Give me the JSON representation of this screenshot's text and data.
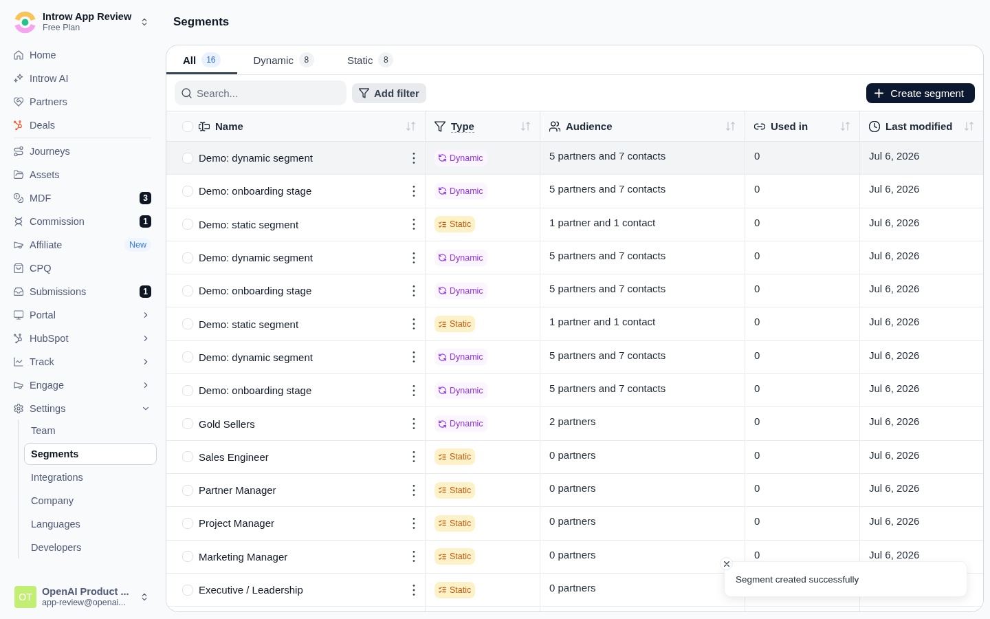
{
  "sidebar": {
    "workspace": {
      "name": "Introw App Review",
      "plan": "Free Plan"
    },
    "nav_groups": [
      {
        "items": [
          {
            "label": "Home",
            "kind": "link",
            "selected": false
          },
          {
            "label": "Introw AI",
            "kind": "link",
            "selected": false
          },
          {
            "label": "Partners",
            "kind": "link",
            "selected": false
          },
          {
            "label": "Deals",
            "kind": "link",
            "selected": false
          }
        ]
      },
      {
        "items": [
          {
            "label": "Journeys",
            "kind": "link",
            "selected": false
          },
          {
            "label": "Assets",
            "kind": "link",
            "selected": false
          },
          {
            "label": "MDF",
            "kind": "link",
            "selected": false,
            "count": "3"
          },
          {
            "label": "Commission",
            "kind": "link",
            "selected": false,
            "count": "1"
          },
          {
            "label": "Affiliate",
            "kind": "link",
            "selected": false,
            "tag": "New"
          },
          {
            "label": "CPQ",
            "kind": "link",
            "selected": false
          },
          {
            "label": "Submissions",
            "kind": "link",
            "selected": false,
            "count": "1"
          },
          {
            "label": "Portal",
            "kind": "group",
            "selected": false,
            "expanded": false
          },
          {
            "label": "HubSpot",
            "kind": "group",
            "selected": false,
            "expanded": false
          },
          {
            "label": "Track",
            "kind": "group",
            "selected": false,
            "expanded": false
          },
          {
            "label": "Engage",
            "kind": "group",
            "selected": false,
            "expanded": false
          },
          {
            "label": "Settings",
            "kind": "group",
            "selected": false,
            "expanded": true,
            "children": [
              {
                "label": "Team",
                "selected": false
              },
              {
                "label": "Segments",
                "selected": true
              },
              {
                "label": "Integrations",
                "selected": false
              },
              {
                "label": "Company",
                "selected": false
              },
              {
                "label": "Languages",
                "selected": false
              },
              {
                "label": "Developers",
                "selected": false
              }
            ]
          }
        ]
      }
    ],
    "account": {
      "initials": "OT",
      "name": "OpenAI Product ...",
      "email": "app-review@openai..."
    }
  },
  "main": {
    "title": "Segments",
    "tabs": [
      {
        "label": "All",
        "count": "16",
        "selected": true
      },
      {
        "label": "Dynamic",
        "count": "8",
        "selected": false
      },
      {
        "label": "Static",
        "count": "8",
        "selected": false
      }
    ],
    "search": {
      "placeholder": "Search..."
    },
    "filter_button": "Add filter",
    "create_button": "Create segment",
    "table": {
      "select_all": {
        "checked": false
      },
      "columns": [
        {
          "label": "Name",
          "has_tooltip": false
        },
        {
          "label": "Type",
          "has_tooltip": true
        },
        {
          "label": "Audience",
          "has_tooltip": false
        },
        {
          "label": "Used in",
          "has_tooltip": false
        },
        {
          "label": "Last modified",
          "has_tooltip": false
        }
      ],
      "rows": [
        {
          "name": "Demo: dynamic segment",
          "type": {
            "kind": "dynamic",
            "label": "Dynamic"
          },
          "audience": "5 partners and 7 contacts",
          "used_in": "0",
          "last_modified": "Jul 6, 2026",
          "checked": false,
          "hovered": true
        },
        {
          "name": "Demo: onboarding stage",
          "type": {
            "kind": "dynamic",
            "label": "Dynamic"
          },
          "audience": "5 partners and 7 contacts",
          "used_in": "0",
          "last_modified": "Jul 6, 2026",
          "checked": false,
          "hovered": false
        },
        {
          "name": "Demo: static segment",
          "type": {
            "kind": "static",
            "label": "Static"
          },
          "audience": "1 partner and 1 contact",
          "used_in": "0",
          "last_modified": "Jul 6, 2026",
          "checked": false,
          "hovered": false
        },
        {
          "name": "Demo: dynamic segment",
          "type": {
            "kind": "dynamic",
            "label": "Dynamic"
          },
          "audience": "5 partners and 7 contacts",
          "used_in": "0",
          "last_modified": "Jul 6, 2026",
          "checked": false,
          "hovered": false
        },
        {
          "name": "Demo: onboarding stage",
          "type": {
            "kind": "dynamic",
            "label": "Dynamic"
          },
          "audience": "5 partners and 7 contacts",
          "used_in": "0",
          "last_modified": "Jul 6, 2026",
          "checked": false,
          "hovered": false
        },
        {
          "name": "Demo: static segment",
          "type": {
            "kind": "static",
            "label": "Static"
          },
          "audience": "1 partner and 1 contact",
          "used_in": "0",
          "last_modified": "Jul 6, 2026",
          "checked": false,
          "hovered": false
        },
        {
          "name": "Demo: dynamic segment",
          "type": {
            "kind": "dynamic",
            "label": "Dynamic"
          },
          "audience": "5 partners and 7 contacts",
          "used_in": "0",
          "last_modified": "Jul 6, 2026",
          "checked": false,
          "hovered": false
        },
        {
          "name": "Demo: onboarding stage",
          "type": {
            "kind": "dynamic",
            "label": "Dynamic"
          },
          "audience": "5 partners and 7 contacts",
          "used_in": "0",
          "last_modified": "Jul 6, 2026",
          "checked": false,
          "hovered": false
        },
        {
          "name": "Gold Sellers",
          "type": {
            "kind": "dynamic",
            "label": "Dynamic"
          },
          "audience": "2 partners",
          "used_in": "0",
          "last_modified": "Jul 6, 2026",
          "checked": false,
          "hovered": false
        },
        {
          "name": "Sales Engineer",
          "type": {
            "kind": "static",
            "label": "Static"
          },
          "audience": "0 partners",
          "used_in": "0",
          "last_modified": "Jul 6, 2026",
          "checked": false,
          "hovered": false
        },
        {
          "name": "Partner Manager",
          "type": {
            "kind": "static",
            "label": "Static"
          },
          "audience": "0 partners",
          "used_in": "0",
          "last_modified": "Jul 6, 2026",
          "checked": false,
          "hovered": false
        },
        {
          "name": "Project Manager",
          "type": {
            "kind": "static",
            "label": "Static"
          },
          "audience": "0 partners",
          "used_in": "0",
          "last_modified": "Jul 6, 2026",
          "checked": false,
          "hovered": false
        },
        {
          "name": "Marketing Manager",
          "type": {
            "kind": "static",
            "label": "Static"
          },
          "audience": "0 partners",
          "used_in": "0",
          "last_modified": "Jul 6, 2026",
          "checked": false,
          "hovered": false
        },
        {
          "name": "Executive / Leadership",
          "type": {
            "kind": "static",
            "label": "Static"
          },
          "audience": "0 partners",
          "checked": false,
          "hovered": false
        }
      ]
    }
  },
  "toast": {
    "message": "Segment created successfully"
  }
}
